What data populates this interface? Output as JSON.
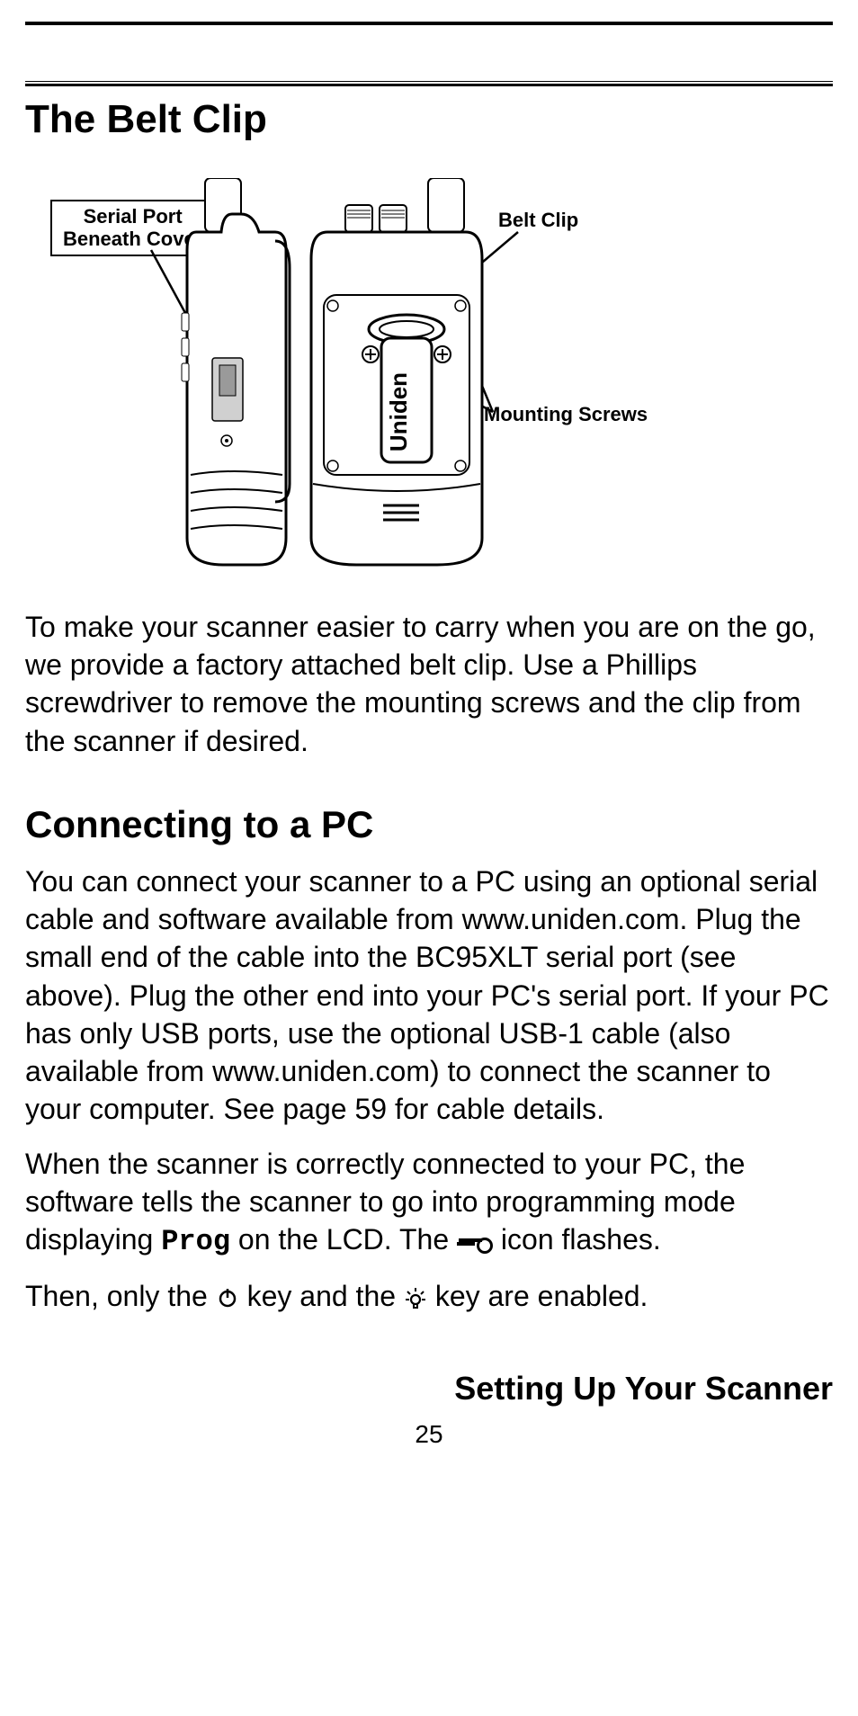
{
  "section1_title": "The Belt Clip",
  "callouts": {
    "serial": "Serial Port\nBeneath Cover",
    "belt": "Belt Clip",
    "screws": "Mounting Screws"
  },
  "device_brand": "Uniden",
  "para1": "To make your scanner easier to carry when you are on the go, we provide a factory attached belt clip. Use a Phillips screwdriver to remove the mounting screws and the clip from the scanner if desired.",
  "section2_title": "Connecting to a PC",
  "para2": "You can connect your scanner to a PC using an optional serial cable and software available from www.uniden.com. Plug the small end of the cable into the BC95XLT serial port (see above). Plug the other end into your PC's serial port. If your PC has only USB ports, use the optional USB-1 cable (also available from www.uniden.com) to connect the scanner to your computer. See page 59 for cable details.",
  "para3_a": "When the scanner is correctly connected to your PC, the software tells the scanner to go into pro­gramming mode displaying ",
  "para3_mono": "Prog",
  "para3_b": " on the LCD. The ",
  "para3_c": " icon flashes.",
  "para4_a": "Then, only the ",
  "para4_b": " key and the ",
  "para4_c": " key are enabled.",
  "footer_title": "Setting Up Your Scanner",
  "page_number": "25"
}
